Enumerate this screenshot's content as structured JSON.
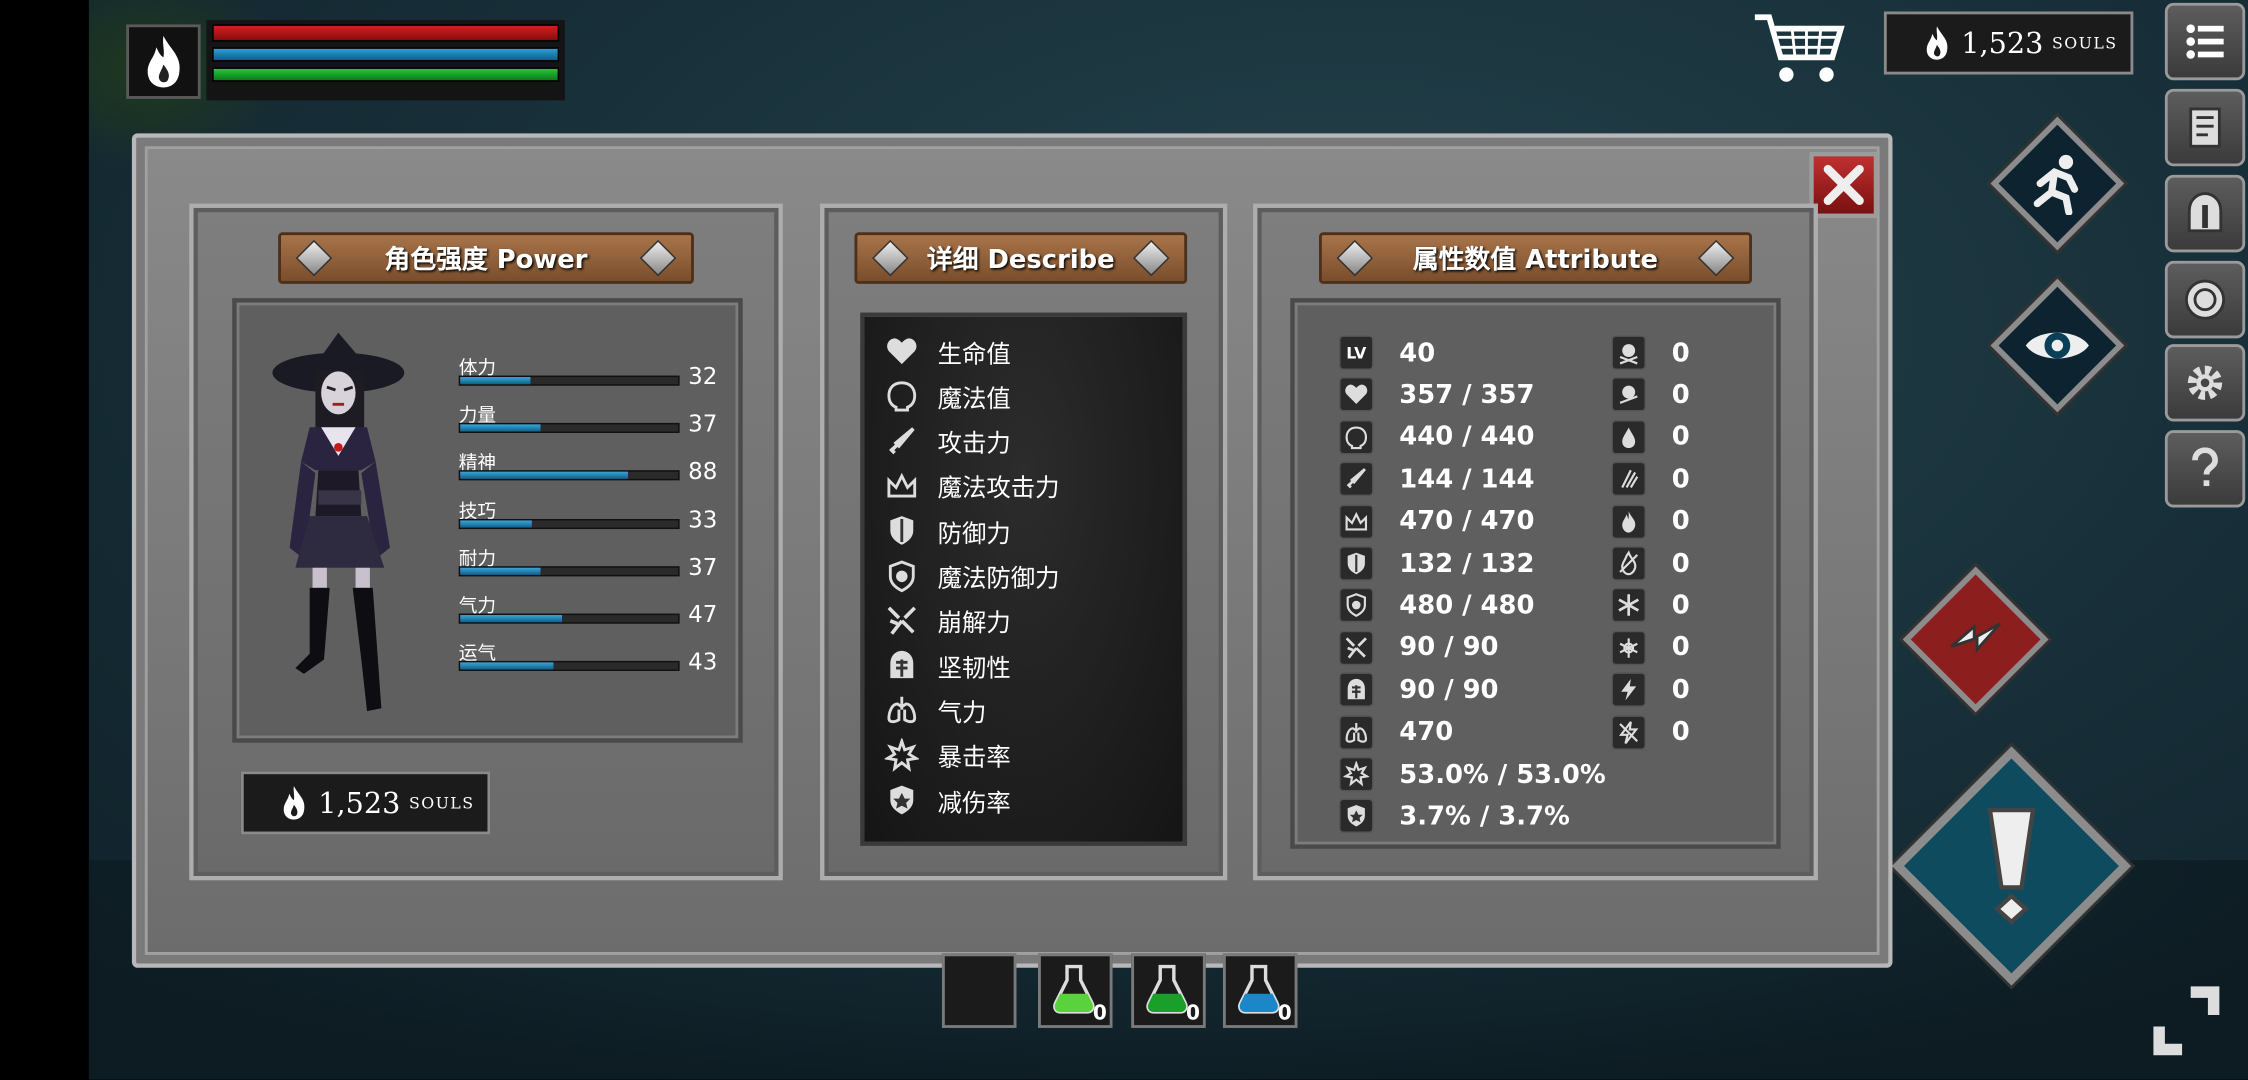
{
  "colors": {
    "hp": "#c41818",
    "mp": "#1d86bb",
    "stamina": "#18a82c",
    "panel": "#7c7c7c",
    "plank": "#94613a",
    "souls_bg": "#1b1b1b"
  },
  "hud": {
    "avatar_icon": "flame-icon"
  },
  "souls": {
    "value": "1,523",
    "unit": "SOULS"
  },
  "panels": {
    "power": {
      "title": "角色强度 Power"
    },
    "describe": {
      "title": "详细 Describe"
    },
    "attribute": {
      "title": "属性数值 Attribute"
    }
  },
  "power_stats": [
    {
      "label": "体力",
      "value": "32",
      "fill": 0.32
    },
    {
      "label": "力量",
      "value": "37",
      "fill": 0.37
    },
    {
      "label": "精神",
      "value": "88",
      "fill": 0.77
    },
    {
      "label": "技巧",
      "value": "33",
      "fill": 0.33
    },
    {
      "label": "耐力",
      "value": "37",
      "fill": 0.37
    },
    {
      "label": "气力",
      "value": "47",
      "fill": 0.47
    },
    {
      "label": "运气",
      "value": "43",
      "fill": 0.43
    }
  ],
  "describe_rows": [
    {
      "label": "生命值",
      "icon": "heart-icon"
    },
    {
      "label": "魔法值",
      "icon": "head-icon"
    },
    {
      "label": "攻击力",
      "icon": "sword-icon"
    },
    {
      "label": "魔法攻击力",
      "icon": "crown-icon"
    },
    {
      "label": "防御力",
      "icon": "shield-icon"
    },
    {
      "label": "魔法防御力",
      "icon": "magic-shield-icon"
    },
    {
      "label": "崩解力",
      "icon": "shatter-icon"
    },
    {
      "label": "坚韧性",
      "icon": "helmet-icon"
    },
    {
      "label": "气力",
      "icon": "lungs-icon"
    },
    {
      "label": "暴击率",
      "icon": "star-burst-icon"
    },
    {
      "label": "减伤率",
      "icon": "guard-icon"
    }
  ],
  "attributes": {
    "level_label": "LV",
    "left": [
      "40",
      "357 / 357",
      "440 / 440",
      "144 / 144",
      "470 / 470",
      "132 / 132",
      "480 / 480",
      "90 / 90",
      "90 / 90",
      "470",
      "53.0% / 53.0%",
      "3.7% / 3.7%"
    ],
    "right": [
      "0",
      "0",
      "0",
      "0",
      "0",
      "0",
      "0",
      "0",
      "0",
      "0"
    ]
  },
  "potions": [
    {
      "color": "empty",
      "count": ""
    },
    {
      "color": "#5ad23c",
      "count": "0"
    },
    {
      "color": "#18a02a",
      "count": "0"
    },
    {
      "color": "#1a88c8",
      "count": "0"
    }
  ]
}
